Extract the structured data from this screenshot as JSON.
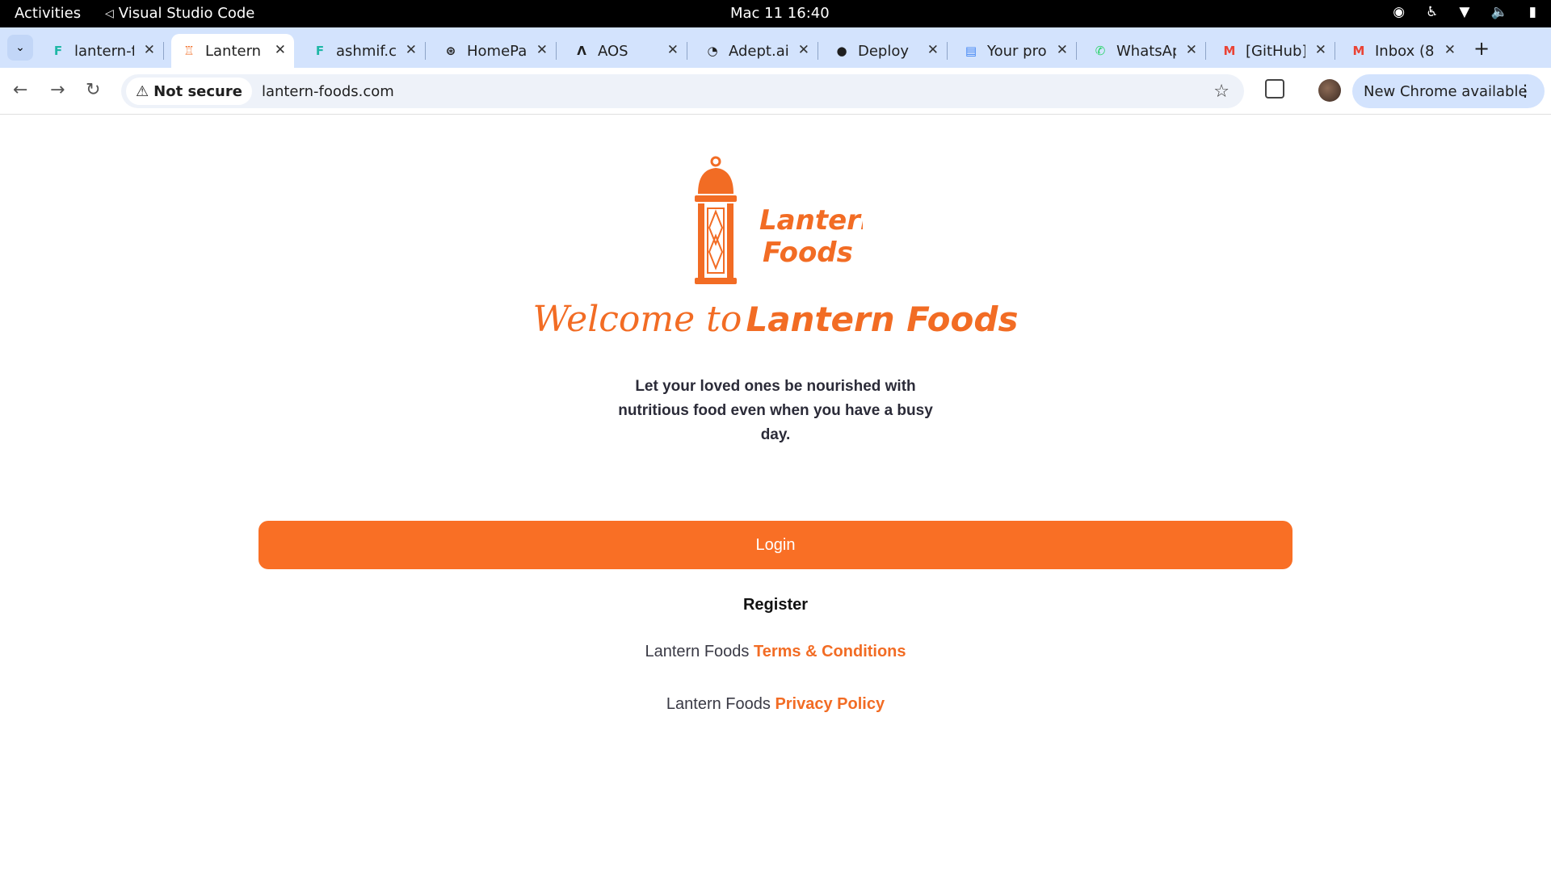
{
  "system_bar": {
    "activities": "Activities",
    "app_name": "Visual Studio Code",
    "clock": "Mac 11  16:40"
  },
  "tabs": [
    {
      "label": "lantern-f",
      "icon": "framer-icon",
      "active": false
    },
    {
      "label": "Lantern",
      "icon": "lantern-favicon",
      "active": true
    },
    {
      "label": "ashmif.c",
      "icon": "framer-icon",
      "active": false
    },
    {
      "label": "HomePa",
      "icon": "openai-icon",
      "active": false
    },
    {
      "label": "AOS",
      "icon": "aos-icon",
      "active": false
    },
    {
      "label": "Adept.ai",
      "icon": "adept-icon",
      "active": false
    },
    {
      "label": "Deploy",
      "icon": "github-icon",
      "active": false
    },
    {
      "label": "Your pro",
      "icon": "docs-icon",
      "active": false
    },
    {
      "label": "WhatsAp",
      "icon": "whatsapp-icon",
      "active": false
    },
    {
      "label": "[GitHub]",
      "icon": "gmail-icon",
      "active": false
    },
    {
      "label": "Inbox (8",
      "icon": "gmail-icon",
      "active": false
    }
  ],
  "toolbar": {
    "security_label": "Not secure",
    "url": "lantern-foods.com",
    "update_label": "New Chrome available"
  },
  "page": {
    "logo_line1": "Lantern",
    "logo_line2": "Foods",
    "welcome_script": "Welcome to",
    "welcome_brand": "Lantern Foods",
    "tagline": "Let your loved ones be nourished with nutritious food even when you have a busy day.",
    "login_label": "Login",
    "register_label": "Register",
    "terms_prefix": "Lantern Foods",
    "terms_link": "Terms & Conditions",
    "privacy_prefix": "Lantern Foods",
    "privacy_link": "Privacy Policy"
  },
  "colors": {
    "brand_orange": "#f96f25",
    "tab_strip": "#d3e3fd"
  }
}
